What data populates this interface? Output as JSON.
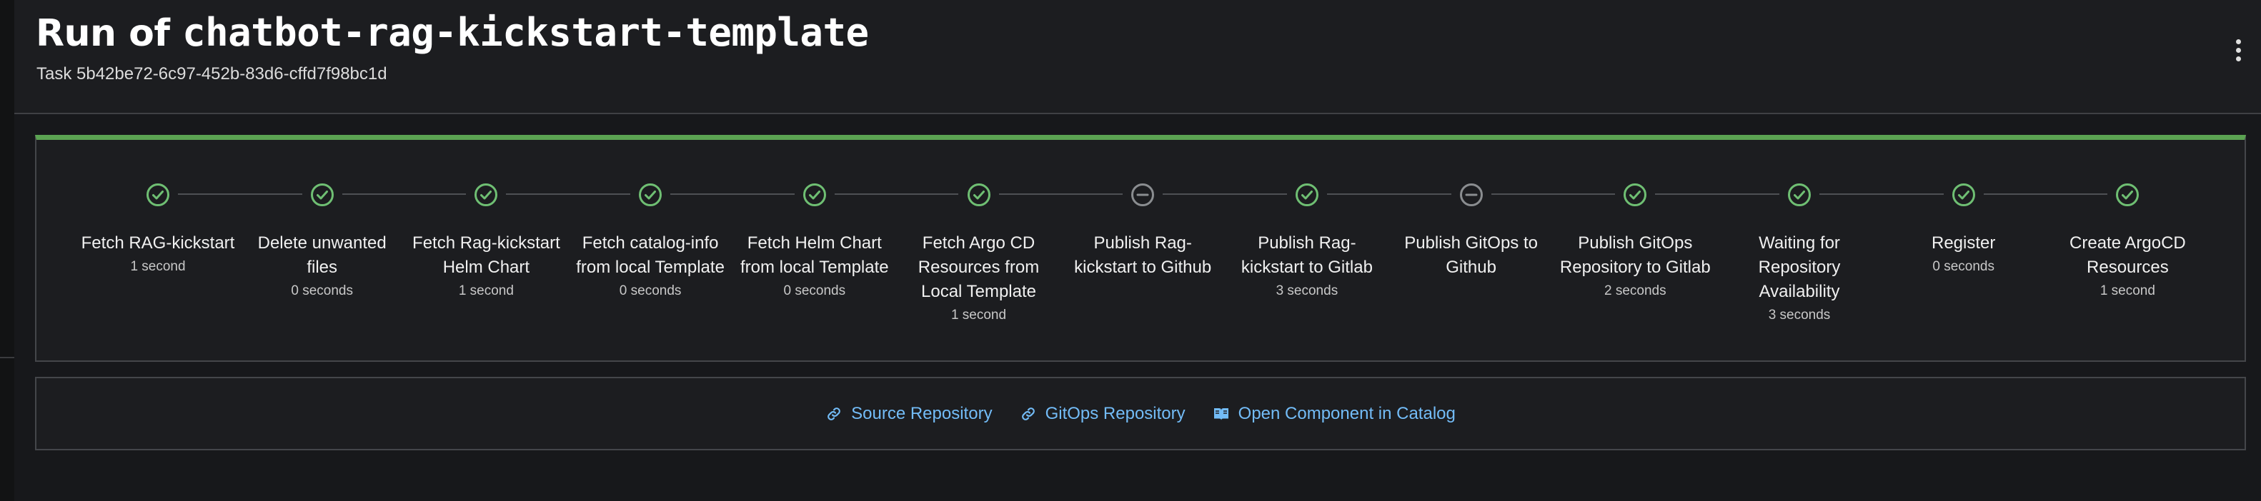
{
  "header": {
    "title_prefix": "Run of ",
    "title_name": "chatbot-rag-kickstart-template",
    "task_label": "Task 5b42be72-6c97-452b-83d6-cffd7f98bc1d",
    "menu_icon": "kebab-vertical-icon"
  },
  "colors": {
    "success": "#6fbf73",
    "skipped": "#8a8d90",
    "link": "#73bcf7",
    "progress_bar": "#5ba352"
  },
  "steps": [
    {
      "label": "Fetch RAG-kickstart",
      "duration": "1 second",
      "status": "completed",
      "icon": "check-circle-icon"
    },
    {
      "label": "Delete unwanted files",
      "duration": "0 seconds",
      "status": "completed",
      "icon": "check-circle-icon"
    },
    {
      "label": "Fetch Rag-kickstart Helm Chart",
      "duration": "1 second",
      "status": "completed",
      "icon": "check-circle-icon"
    },
    {
      "label": "Fetch catalog-info from local Template",
      "duration": "0 seconds",
      "status": "completed",
      "icon": "check-circle-icon"
    },
    {
      "label": "Fetch Helm Chart from local Template",
      "duration": "0 seconds",
      "status": "completed",
      "icon": "check-circle-icon"
    },
    {
      "label": "Fetch Argo CD Resources from Local Template",
      "duration": "1 second",
      "status": "completed",
      "icon": "check-circle-icon"
    },
    {
      "label": "Publish Rag-kickstart to Github",
      "duration": "",
      "status": "skipped",
      "icon": "minus-circle-icon"
    },
    {
      "label": "Publish Rag-kickstart to Gitlab",
      "duration": "3 seconds",
      "status": "completed",
      "icon": "check-circle-icon"
    },
    {
      "label": "Publish GitOps to Github",
      "duration": "",
      "status": "skipped",
      "icon": "minus-circle-icon"
    },
    {
      "label": "Publish GitOps Repository to Gitlab",
      "duration": "2 seconds",
      "status": "completed",
      "icon": "check-circle-icon"
    },
    {
      "label": "Waiting for Repository Availability",
      "duration": "3 seconds",
      "status": "completed",
      "icon": "check-circle-icon"
    },
    {
      "label": "Register",
      "duration": "0 seconds",
      "status": "completed",
      "icon": "check-circle-icon"
    },
    {
      "label": "Create ArgoCD Resources",
      "duration": "1 second",
      "status": "completed",
      "icon": "check-circle-icon"
    }
  ],
  "links": [
    {
      "label": "Source Repository",
      "icon": "link-icon"
    },
    {
      "label": "GitOps Repository",
      "icon": "link-icon"
    },
    {
      "label": "Open Component in Catalog",
      "icon": "book-icon"
    }
  ]
}
